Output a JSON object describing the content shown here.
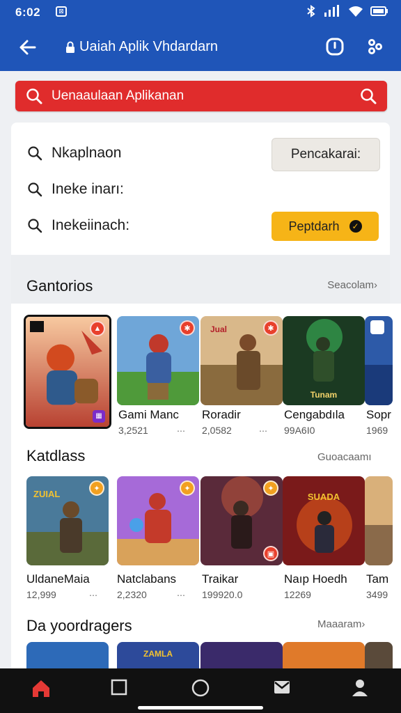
{
  "status": {
    "time": "6:02",
    "notif": "⊠"
  },
  "appbar": {
    "title": "Uaiah Aplik Vhdardarn"
  },
  "search": {
    "text": "Uenaaulaan Aplikanan"
  },
  "filters": {
    "row1": "Nkaplnaon",
    "row2": "Ineke inarı:",
    "row3": "Inekeiinach:",
    "btn1": "Pencakarai:",
    "btn2": "Peptdarh"
  },
  "sections": [
    {
      "title": "Gantorios",
      "link": "Seacolam›",
      "items": [
        {
          "name": "",
          "num": ""
        },
        {
          "name": "Gami Manc",
          "num": "3,2521"
        },
        {
          "name": "Roradir",
          "num": "2,0582"
        },
        {
          "name": "Cengabdıla",
          "num": "99A6I0"
        },
        {
          "name": "Sopr",
          "num": "1969"
        }
      ]
    },
    {
      "title": "Katdlass",
      "link": "Guoacaamı",
      "items": [
        {
          "name": "UldaneMaia",
          "num": "12,999"
        },
        {
          "name": "Natclabans",
          "num": "2,2320"
        },
        {
          "name": "Traikar",
          "num": "199920.0"
        },
        {
          "name": "Naıp Hoedh",
          "num": "12269"
        },
        {
          "name": "Tam",
          "num": "3499"
        }
      ]
    },
    {
      "title": "Da yoordragers",
      "link": "Maaaram›"
    }
  ],
  "tile_art": {
    "t1": "Jual",
    "t2": "Tunam",
    "t3": "ZUIAL",
    "t4": "SUADA",
    "t5": "ZAMLA"
  },
  "colors": {
    "brand": "#1f55b8",
    "search": "#e02c2c",
    "accent": "#f6b417"
  }
}
